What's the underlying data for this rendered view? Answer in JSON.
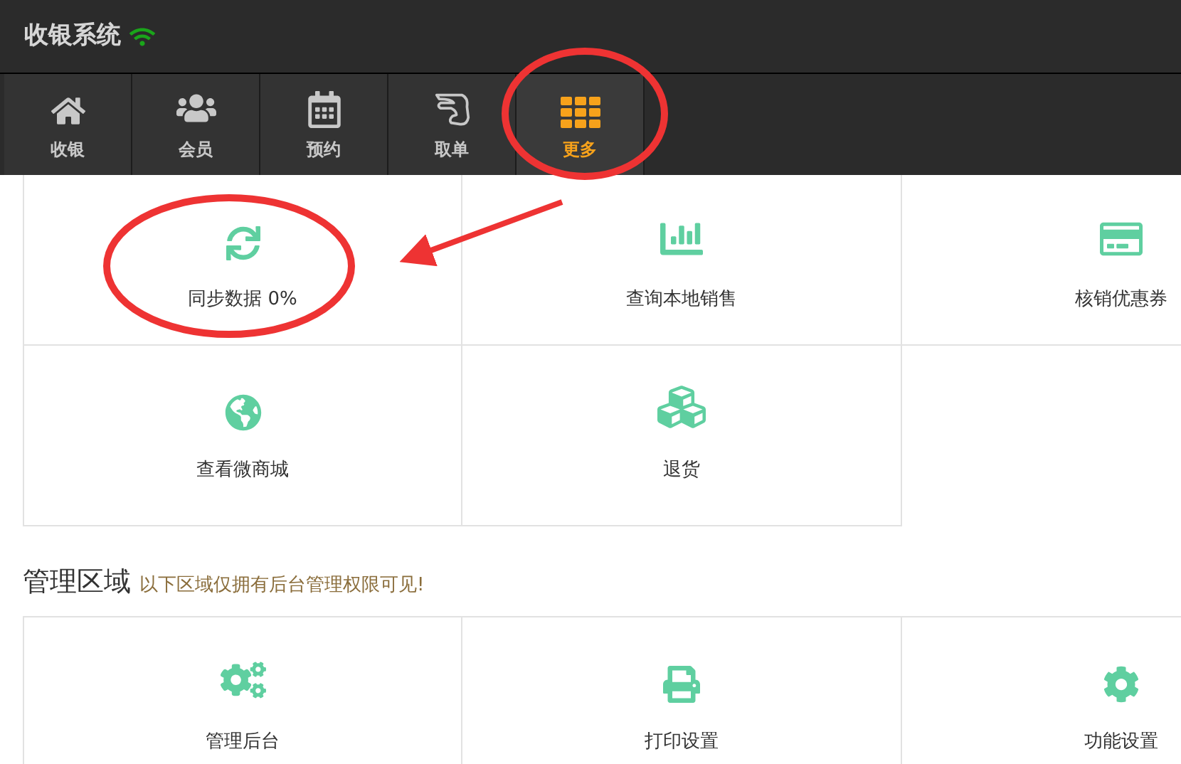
{
  "header": {
    "title": "收银系统"
  },
  "tabs": [
    {
      "label": "收银",
      "kind": "home",
      "selected": false
    },
    {
      "label": "会员",
      "kind": "users",
      "selected": false
    },
    {
      "label": "预约",
      "kind": "calendar",
      "selected": false
    },
    {
      "label": "取单",
      "kind": "hand",
      "selected": false
    },
    {
      "label": "更多",
      "kind": "grid",
      "selected": true
    }
  ],
  "tools": [
    {
      "label": "同步数据 0%",
      "kind": "sync"
    },
    {
      "label": "查询本地销售",
      "kind": "chart"
    },
    {
      "label": "核销优惠券",
      "kind": "card"
    },
    {
      "label": "查看微商城",
      "kind": "globe"
    },
    {
      "label": "退货",
      "kind": "cubes"
    }
  ],
  "admin_section": {
    "title": "管理区域",
    "note": "以下区域仅拥有后台管理权限可见!",
    "items": [
      {
        "label": "管理后台",
        "kind": "cogs"
      },
      {
        "label": "打印设置",
        "kind": "print"
      },
      {
        "label": "功能设置",
        "kind": "cog"
      }
    ]
  }
}
